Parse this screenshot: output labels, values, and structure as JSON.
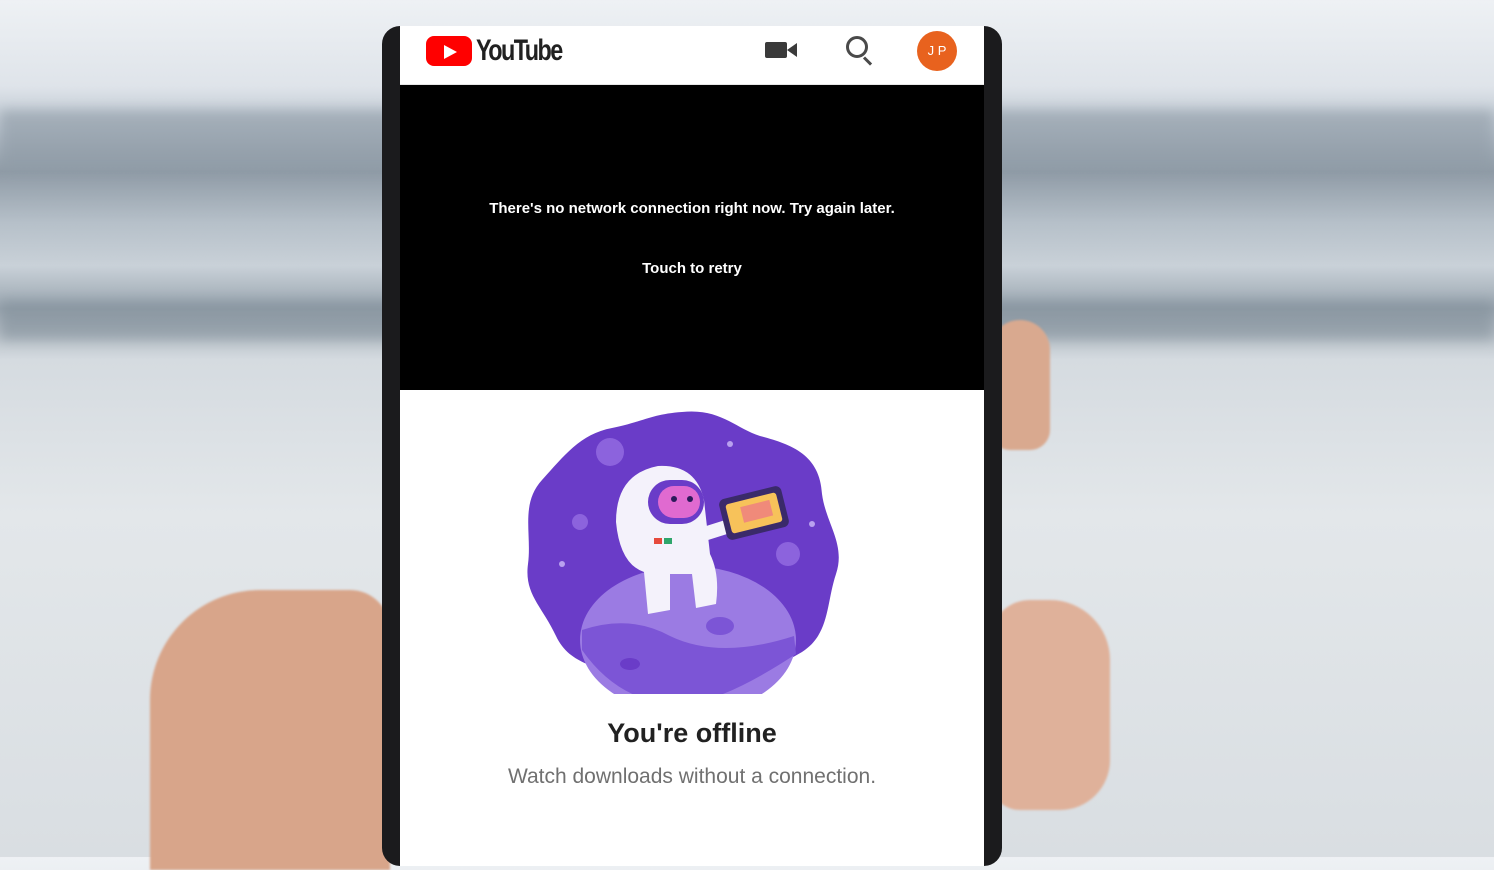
{
  "app": {
    "logo_text": "YouTube",
    "avatar_initials": "J P"
  },
  "header_icons": [
    "video-camera-icon",
    "search-icon",
    "avatar"
  ],
  "player": {
    "error_message": "There's no network connection right now. Try again later.",
    "retry_label": "Touch to retry"
  },
  "offline": {
    "title": "You're offline",
    "subtitle": "Watch downloads without a connection."
  },
  "colors": {
    "brand_red": "#ff0000",
    "avatar_orange": "#e8621e",
    "illustration_purple": "#6a3cc8",
    "player_bg": "#000000"
  }
}
